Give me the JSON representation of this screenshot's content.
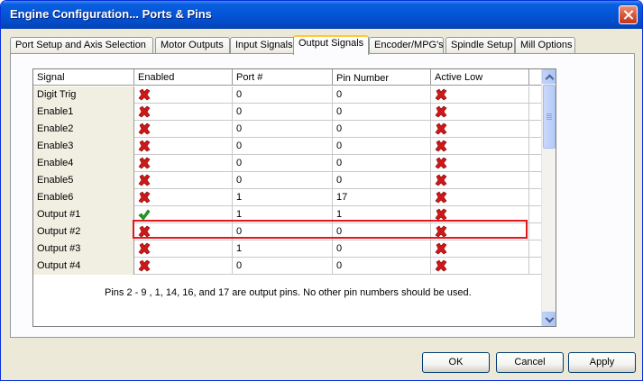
{
  "window": {
    "title": "Engine Configuration... Ports & Pins"
  },
  "tabs": [
    {
      "label": "Port Setup and Axis Selection",
      "active": false
    },
    {
      "label": "Motor Outputs",
      "active": false
    },
    {
      "label": "Input Signals",
      "active": false
    },
    {
      "label": "Output Signals",
      "active": true
    },
    {
      "label": "Encoder/MPG's",
      "active": false
    },
    {
      "label": "Spindle Setup",
      "active": false
    },
    {
      "label": "Mill Options",
      "active": false
    }
  ],
  "grid": {
    "columns": [
      "Signal",
      "Enabled",
      "Port #",
      "Pin Number",
      "Active Low"
    ],
    "rows": [
      {
        "signal": "Digit  Trig",
        "enabled": "x-icon",
        "port": "0",
        "pin": "0",
        "active_low": "x-icon"
      },
      {
        "signal": "Enable1",
        "enabled": "x-icon",
        "port": "0",
        "pin": "0",
        "active_low": "x-icon"
      },
      {
        "signal": "Enable2",
        "enabled": "x-icon",
        "port": "0",
        "pin": "0",
        "active_low": "x-icon"
      },
      {
        "signal": "Enable3",
        "enabled": "x-icon",
        "port": "0",
        "pin": "0",
        "active_low": "x-icon"
      },
      {
        "signal": "Enable4",
        "enabled": "x-icon",
        "port": "0",
        "pin": "0",
        "active_low": "x-icon"
      },
      {
        "signal": "Enable5",
        "enabled": "x-icon",
        "port": "0",
        "pin": "0",
        "active_low": "x-icon"
      },
      {
        "signal": "Enable6",
        "enabled": "x-icon",
        "port": "1",
        "pin": "17",
        "active_low": "x-icon"
      },
      {
        "signal": "Output #1",
        "enabled": "check-icon",
        "port": "1",
        "pin": "1",
        "active_low": "x-icon"
      },
      {
        "signal": "Output #2",
        "enabled": "x-icon",
        "port": "0",
        "pin": "0",
        "active_low": "x-icon"
      },
      {
        "signal": "Output #3",
        "enabled": "x-icon",
        "port": "1",
        "pin": "0",
        "active_low": "x-icon"
      },
      {
        "signal": "Output #4",
        "enabled": "x-icon",
        "port": "0",
        "pin": "0",
        "active_low": "x-icon"
      }
    ]
  },
  "note": "Pins 2 - 9 , 1, 14, 16, and 17 are output pins. No  other pin numbers should be used.",
  "buttons": {
    "ok": "OK",
    "cancel": "Cancel",
    "apply": "Apply"
  },
  "colors": {
    "highlight": "#e0181d",
    "title_bar": "#0454d6",
    "x_icon": "#d01818",
    "check_icon": "#1fa21f"
  }
}
